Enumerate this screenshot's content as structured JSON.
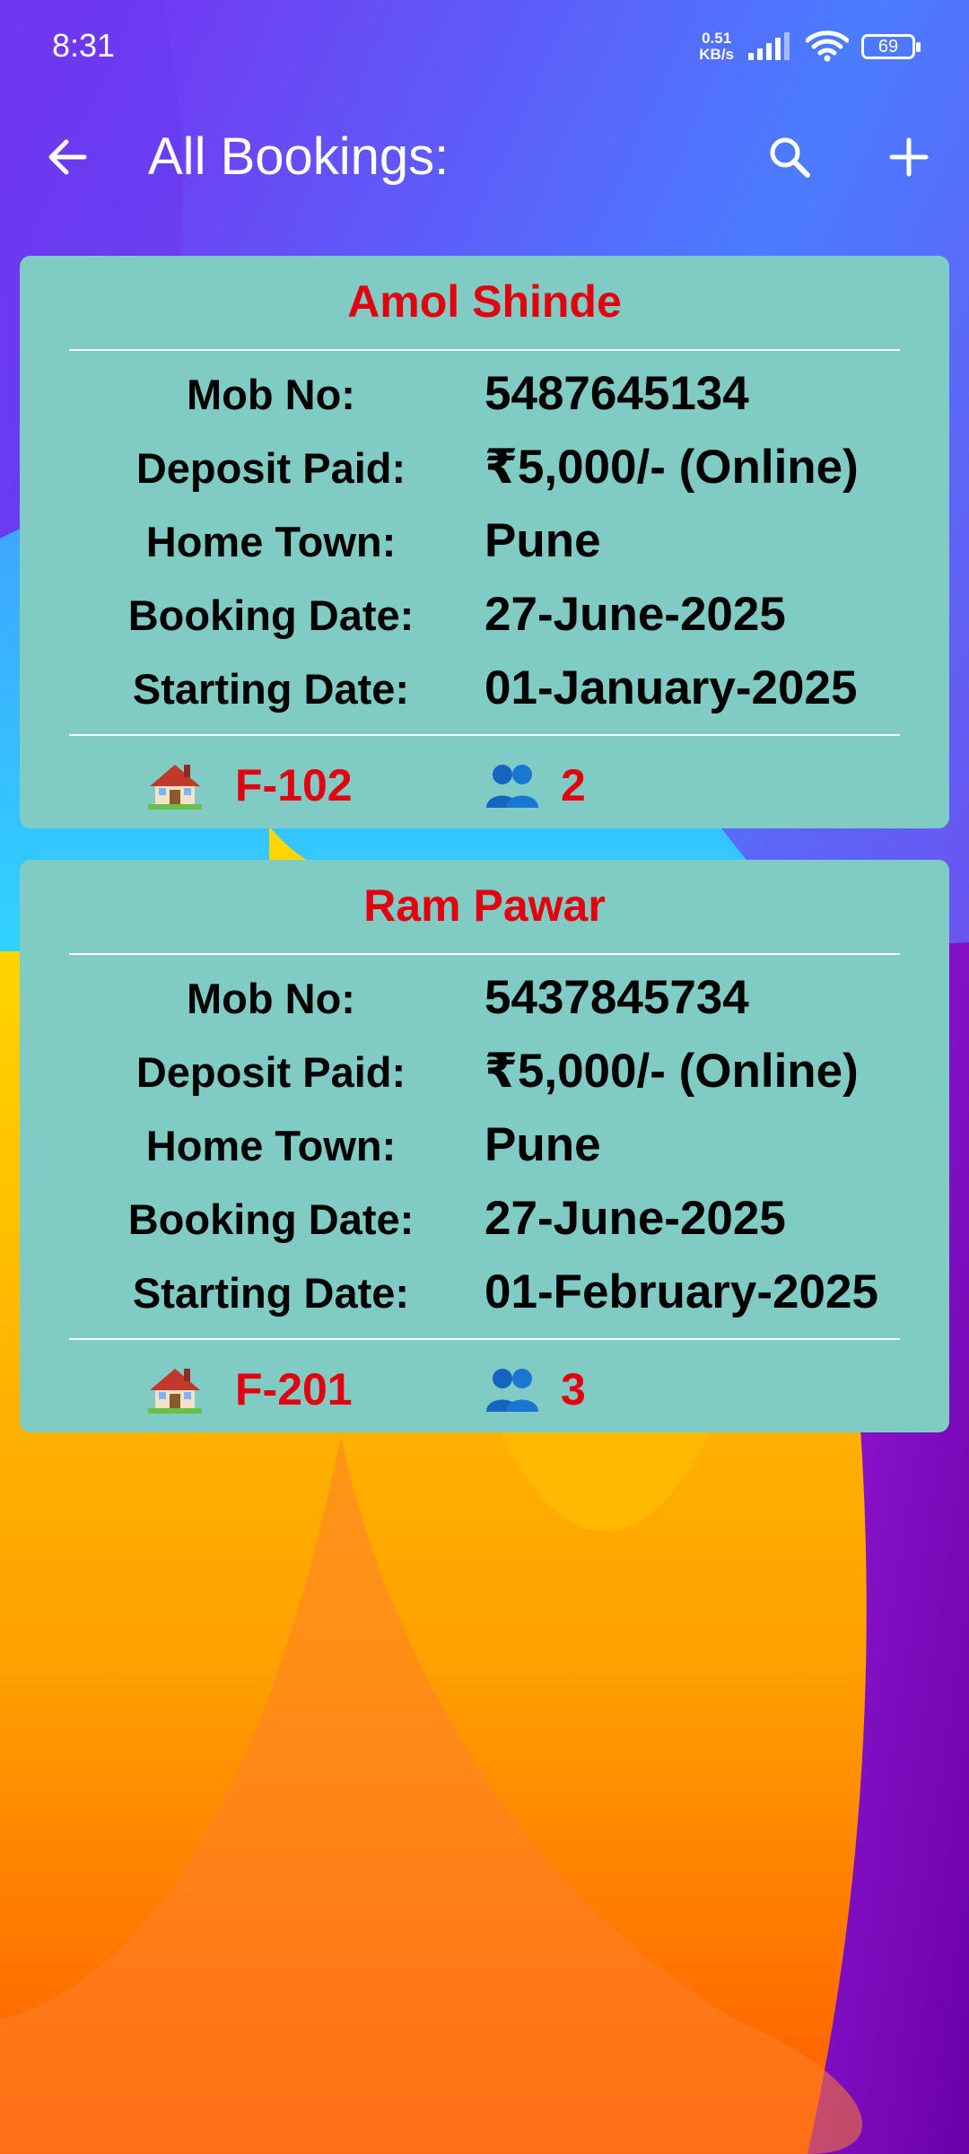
{
  "status": {
    "time": "8:31",
    "net_speed_value": "0.51",
    "net_speed_unit": "KB/s",
    "battery": "69"
  },
  "appbar": {
    "title": "All Bookings:",
    "back_icon": "arrow-left-icon",
    "search_icon": "search-icon",
    "add_icon": "plus-icon"
  },
  "bookings": [
    {
      "name": "Amol Shinde",
      "fields": [
        {
          "label": "Mob No:",
          "value": "5487645134"
        },
        {
          "label": "Deposit Paid:",
          "value": "₹5,000/- (Online)"
        },
        {
          "label": "Home Town:",
          "value": "Pune"
        },
        {
          "label": "Booking Date:",
          "value": "27-June-2025"
        },
        {
          "label": "Starting Date:",
          "value": "01-January-2025"
        }
      ],
      "flat": "F-102",
      "persons": "2"
    },
    {
      "name": "Ram Pawar",
      "fields": [
        {
          "label": "Mob No:",
          "value": "5437845734"
        },
        {
          "label": "Deposit Paid:",
          "value": "₹5,000/- (Online)"
        },
        {
          "label": "Home Town:",
          "value": "Pune"
        },
        {
          "label": "Booking Date:",
          "value": "27-June-2025"
        },
        {
          "label": "Starting Date:",
          "value": "01-February-2025"
        }
      ],
      "flat": "F-201",
      "persons": "3"
    }
  ],
  "colors": {
    "card_bg": "#80cbc4",
    "accent_red": "#e3000f"
  }
}
